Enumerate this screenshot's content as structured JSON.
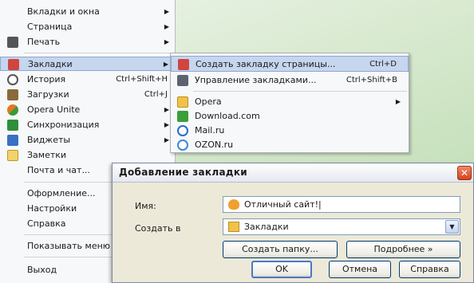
{
  "menu": {
    "items": [
      {
        "label": "Вкладки и окна",
        "arrow": "▶"
      },
      {
        "label": "Страница",
        "arrow": "▶"
      },
      {
        "label": "Печать",
        "arrow": "▶"
      },
      {
        "label": "Закладки",
        "arrow": "▶"
      },
      {
        "label": "История",
        "shortcut": "Ctrl+Shift+H"
      },
      {
        "label": "Загрузки",
        "shortcut": "Ctrl+J"
      },
      {
        "label": "Opera Unite",
        "arrow": "▶"
      },
      {
        "label": "Синхронизация",
        "arrow": "▶"
      },
      {
        "label": "Виджеты",
        "arrow": "▶"
      },
      {
        "label": "Заметки"
      },
      {
        "label": "Почта и чат..."
      },
      {
        "label": "Оформление..."
      },
      {
        "label": "Настройки"
      },
      {
        "label": "Справка"
      },
      {
        "label": "Показывать меню"
      },
      {
        "label": "Выход"
      }
    ]
  },
  "submenu": {
    "items": [
      {
        "label": "Создать закладку страницы...",
        "shortcut": "Ctrl+D"
      },
      {
        "label": "Управление закладками...",
        "shortcut": "Ctrl+Shift+B"
      },
      {
        "label": "Opera",
        "arrow": "▶"
      },
      {
        "label": "Download.com"
      },
      {
        "label": "Mail.ru"
      },
      {
        "label": "OZON.ru"
      }
    ]
  },
  "dialog": {
    "title": "Добавление закладки",
    "close": "✕",
    "name_label": "Имя:",
    "name_value": "Отличный сайт!|",
    "folder_label": "Создать в",
    "folder_value": "Закладки",
    "dropdown_arrow": "▼",
    "buttons": {
      "new_folder": "Создать папку...",
      "details": "Подробнее »",
      "ok": "OK",
      "cancel": "Отмена",
      "help": "Справка"
    }
  },
  "colors": {
    "highlight": "#c5d6ee",
    "dialog_bg": "#ece9d8",
    "close_button": "#d4431d"
  }
}
